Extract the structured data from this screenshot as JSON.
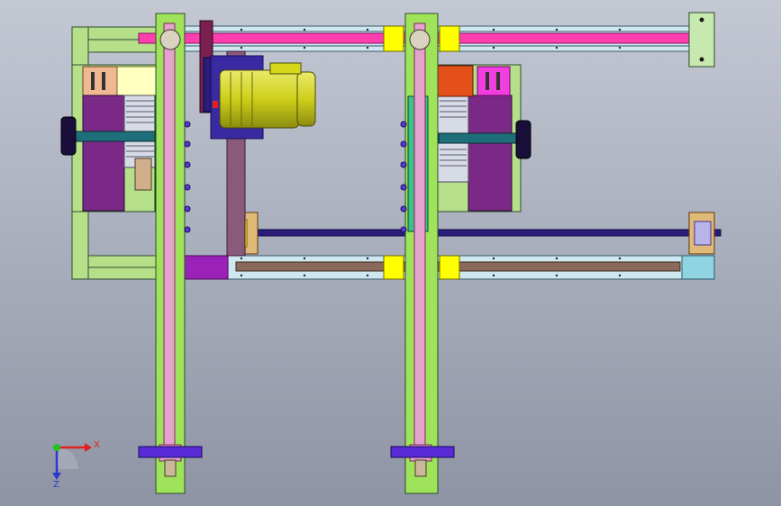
{
  "viewport": {
    "background_top": "#c3c8d3",
    "background_bottom": "#8e94a4"
  },
  "triad": {
    "x_label": "X",
    "z_label": "Z",
    "x_color": "#e02020",
    "y_color": "#22c022",
    "z_color": "#2a3ad0"
  },
  "colors": {
    "frame_green": "#b6df8a",
    "column_lime": "#9ee35a",
    "belt_pink": "#e6a2cf",
    "rail_cyan": "#cfe7ef",
    "magenta_bar": "#ff3fb0",
    "yellow_block": "#ffff00",
    "purple_plate": "#7a2a86",
    "motor_olive": "#cfcf1a",
    "shaft_navy": "#2a1c7a",
    "orange_block": "#e4501a",
    "dark_green": "#1e7a1e",
    "teal_shaft": "#1f6f7a"
  }
}
